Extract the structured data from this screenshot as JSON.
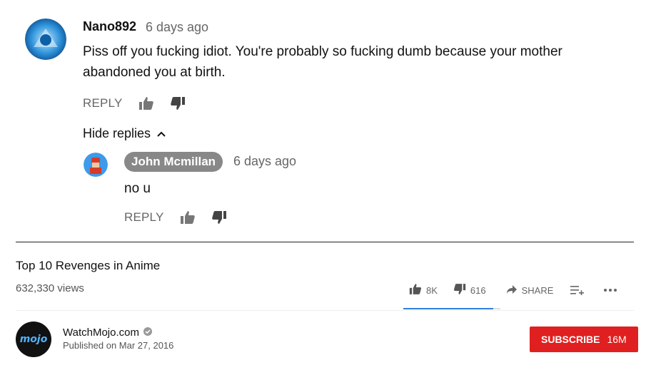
{
  "comment": {
    "author": "Nano892",
    "time": "6 days ago",
    "text": "Piss off you fucking idiot. You're probably so fucking dumb because your mother abandoned you at birth.",
    "reply_label": "REPLY"
  },
  "hide_replies_label": "Hide replies",
  "reply": {
    "author": "John Mcmillan",
    "time": "6 days ago",
    "text": "no u",
    "reply_label": "REPLY"
  },
  "video": {
    "title": "Top 10 Revenges in Anime",
    "views": "632,330 views",
    "likes": "8K",
    "dislikes": "616",
    "share_label": "SHARE",
    "sentiment_like_fraction": 0.93
  },
  "channel": {
    "name": "WatchMojo.com",
    "published": "Published on Mar 27, 2016",
    "logo_text": "mojo",
    "subscribe_label": "SUBSCRIBE",
    "subscriber_count": "16M"
  },
  "colors": {
    "accent": "#e02020",
    "sentiment": "#2f7fe0"
  },
  "icons": [
    "thumbs-up-icon",
    "thumbs-down-icon",
    "chevron-up-icon",
    "share-icon",
    "add-to-playlist-icon",
    "more-icon",
    "verified-icon"
  ]
}
